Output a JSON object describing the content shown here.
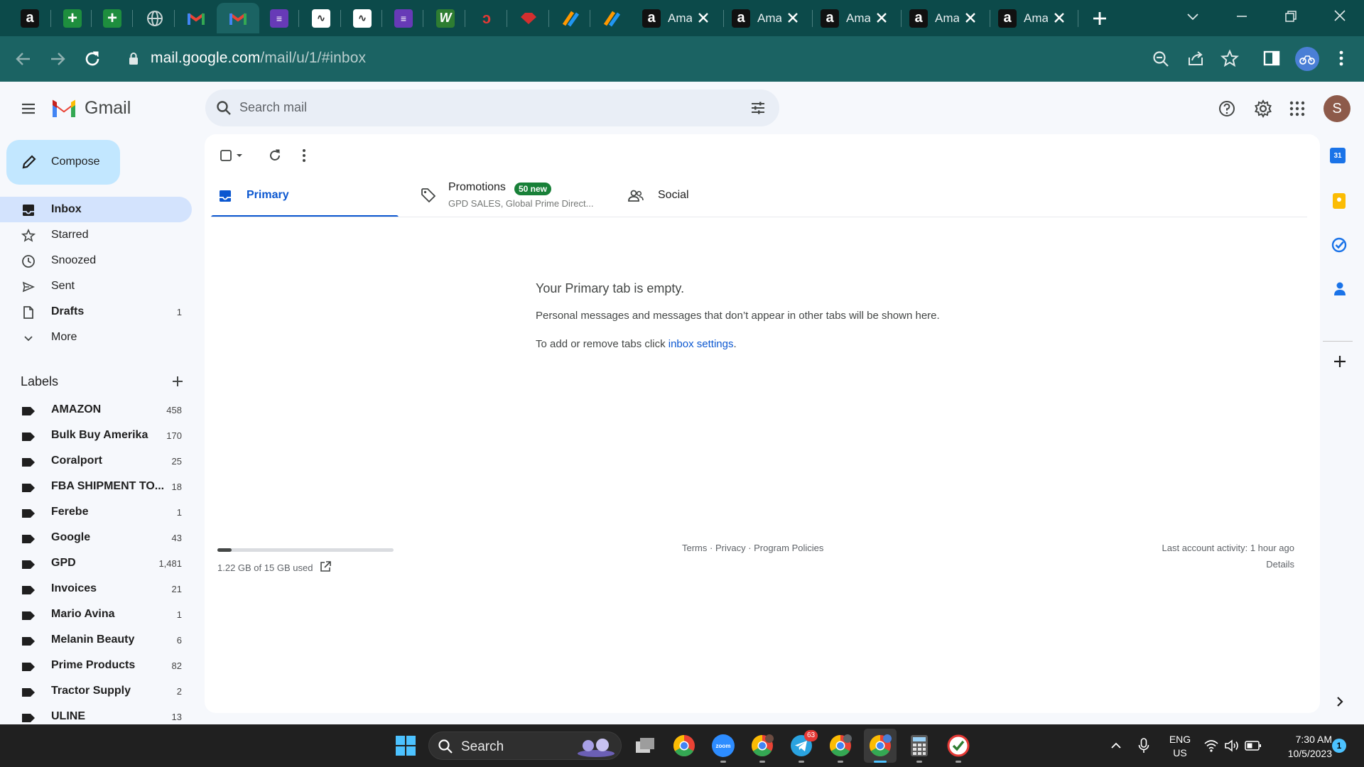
{
  "browser": {
    "amazon_tab_title": "Amazon",
    "url_host": "mail.google.com",
    "url_path": "/mail/u/1/#inbox"
  },
  "gmail": {
    "product_name": "Gmail",
    "search_placeholder": "Search mail",
    "avatar_letter": "S",
    "compose_label": "Compose",
    "nav": [
      {
        "label": "Inbox",
        "count": "",
        "icon": "inbox-icon"
      },
      {
        "label": "Starred",
        "count": "",
        "icon": "star-icon"
      },
      {
        "label": "Snoozed",
        "count": "",
        "icon": "clock-icon"
      },
      {
        "label": "Sent",
        "count": "",
        "icon": "send-icon"
      },
      {
        "label": "Drafts",
        "count": "1",
        "icon": "draft-icon"
      },
      {
        "label": "More",
        "count": "",
        "icon": "chevron-down-icon"
      }
    ],
    "labels_heading": "Labels",
    "labels": [
      {
        "name": "AMAZON",
        "count": "458"
      },
      {
        "name": "Bulk Buy Amerika",
        "count": "170"
      },
      {
        "name": "Coralport",
        "count": "25"
      },
      {
        "name": "FBA SHIPMENT TO...",
        "count": "18"
      },
      {
        "name": "Ferebe",
        "count": "1"
      },
      {
        "name": "Google",
        "count": "43"
      },
      {
        "name": "GPD",
        "count": "1,481"
      },
      {
        "name": "Invoices",
        "count": "21"
      },
      {
        "name": "Mario Avina",
        "count": "1"
      },
      {
        "name": "Melanin Beauty",
        "count": "6"
      },
      {
        "name": "Prime Products",
        "count": "82"
      },
      {
        "name": "Tractor Supply",
        "count": "2"
      },
      {
        "name": "ULINE",
        "count": "13"
      }
    ],
    "tabs": {
      "primary": "Primary",
      "promotions": "Promotions",
      "promotions_badge": "50 new",
      "promotions_snippet": "GPD SALES, Global Prime Direct...",
      "social": "Social"
    },
    "empty_state": {
      "title": "Your Primary tab is empty.",
      "line1": "Personal messages and messages that don’t appear in other tabs will be shown here.",
      "line2_prefix": "To add or remove tabs click ",
      "line2_link": "inbox settings",
      "line2_suffix": "."
    },
    "footer": {
      "storage_text": "1.22 GB of 15 GB used",
      "storage_fraction": 0.081,
      "terms": "Terms",
      "sep": " · ",
      "privacy": "Privacy",
      "program_policies": "Program Policies",
      "last_activity": "Last account activity: 1 hour ago",
      "details": "Details"
    }
  },
  "taskbar": {
    "search_label": "Search",
    "telegram_badge": "63",
    "lang_top": "ENG",
    "lang_bottom": "US",
    "time": "7:30 AM",
    "date": "10/5/2023",
    "notif_count": "1"
  },
  "colors": {
    "chrome_dark": "#0c4a4a",
    "chrome_light": "#1b6363",
    "gmail_bg": "#f6f8fc",
    "selected": "#d3e3fd",
    "accent_blue": "#0b57d0",
    "badge_green": "#188038",
    "compose_bg": "#c2e7ff"
  }
}
